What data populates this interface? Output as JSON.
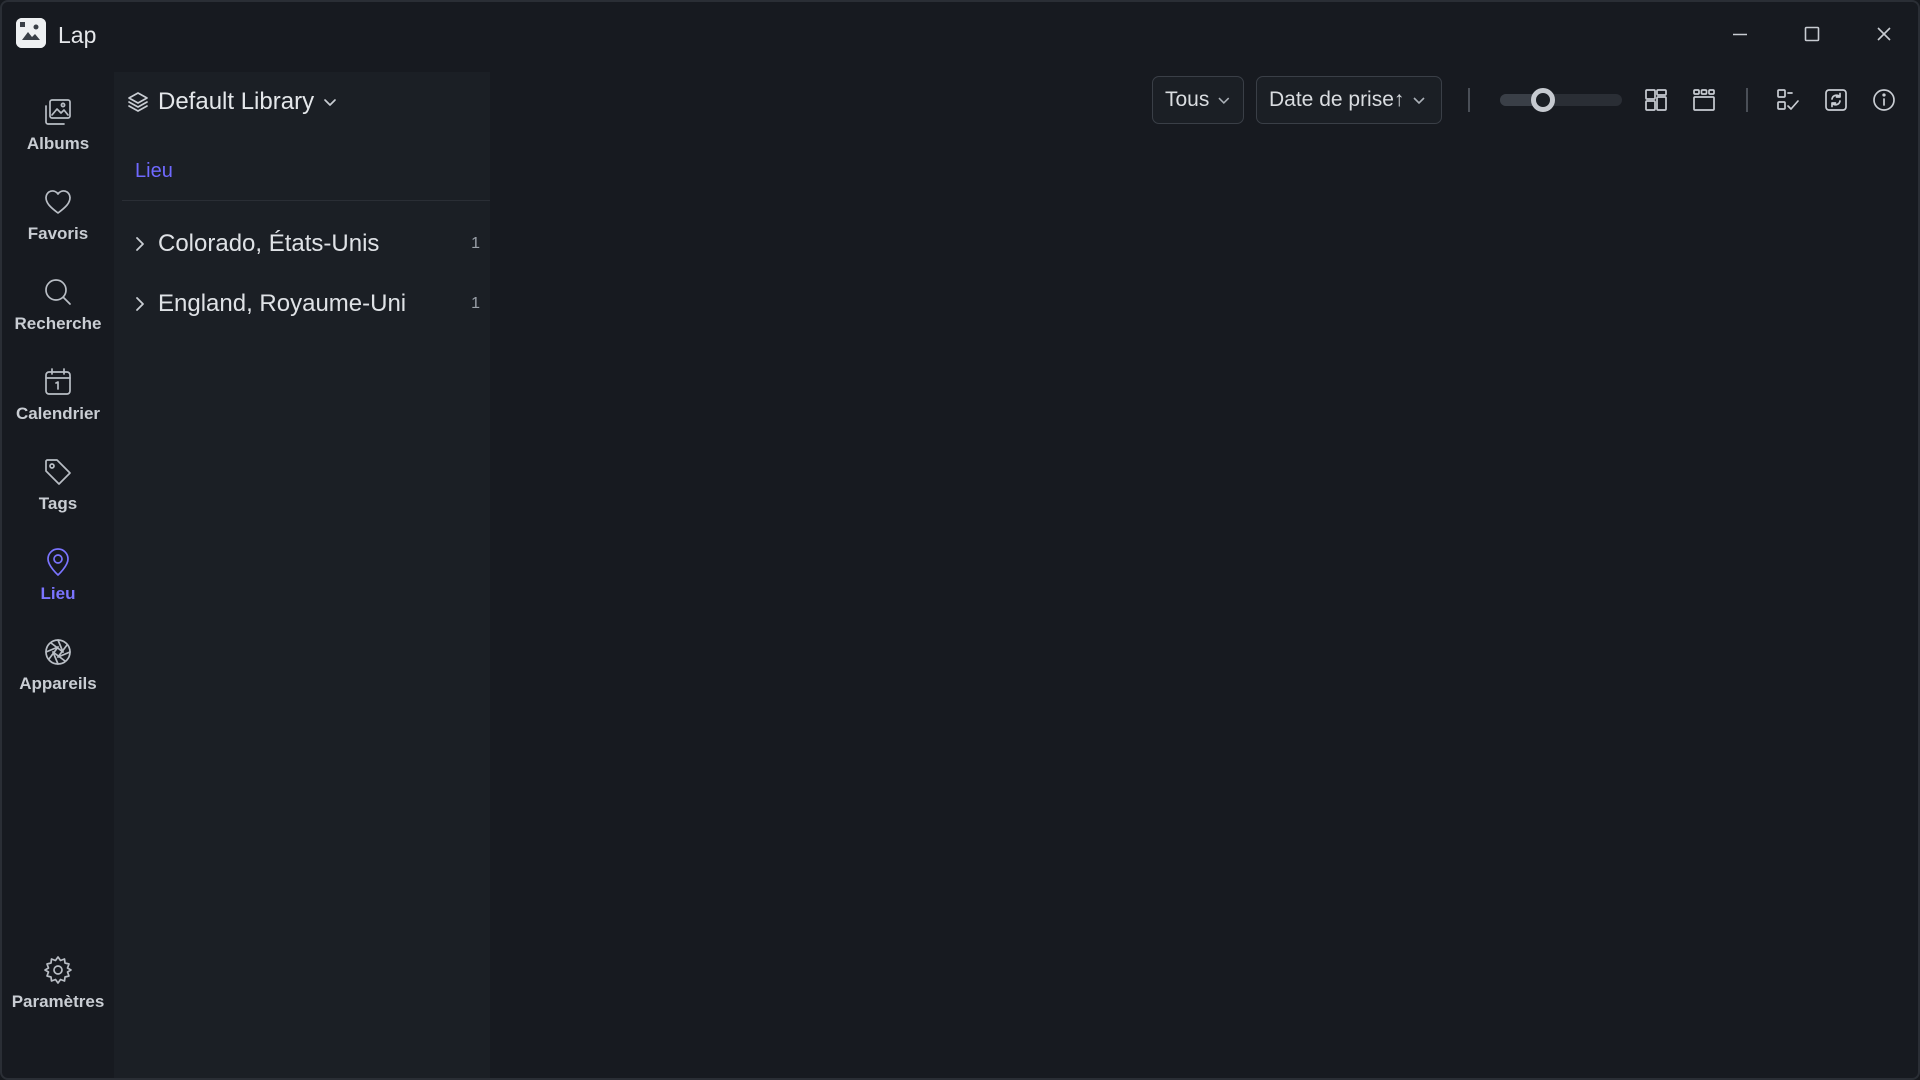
{
  "app": {
    "title": "Lap",
    "colors": {
      "accent": "#7b74ff",
      "background": "#171a20",
      "panel": "#1b1f25"
    }
  },
  "window_controls": [
    {
      "name": "minimize-icon"
    },
    {
      "name": "maximize-icon"
    },
    {
      "name": "close-icon"
    }
  ],
  "nav": {
    "items": [
      {
        "id": "albums",
        "label": "Albums",
        "icon": "images-icon",
        "active": false
      },
      {
        "id": "favoris",
        "label": "Favoris",
        "icon": "heart-icon",
        "active": false
      },
      {
        "id": "recherche",
        "label": "Recherche",
        "icon": "search-icon",
        "active": false
      },
      {
        "id": "calendrier",
        "label": "Calendrier",
        "icon": "calendar-icon",
        "active": false
      },
      {
        "id": "tags",
        "label": "Tags",
        "icon": "tag-icon",
        "active": false
      },
      {
        "id": "lieu",
        "label": "Lieu",
        "icon": "map-pin-icon",
        "active": true
      },
      {
        "id": "appareils",
        "label": "Appareils",
        "icon": "camera-aperture-icon",
        "active": false
      }
    ],
    "settings": {
      "label": "Paramètres",
      "icon": "gear-icon"
    }
  },
  "library": {
    "name": "Default Library",
    "icon": "layers-icon"
  },
  "panel": {
    "section_title": "Lieu",
    "locations": [
      {
        "name": "Colorado, États-Unis",
        "count": "1"
      },
      {
        "name": "England, Royaume-Uni",
        "count": "1"
      }
    ]
  },
  "toolbar": {
    "filter": {
      "selected": "Tous"
    },
    "sort": {
      "selected": "Date de prise↑"
    },
    "thumbnail_size": {
      "level": 0.35
    },
    "buttons": [
      {
        "name": "grid-view-icon"
      },
      {
        "name": "timeline-view-icon"
      },
      {
        "name": "select-icon"
      },
      {
        "name": "refresh-icon"
      },
      {
        "name": "info-icon"
      }
    ]
  }
}
